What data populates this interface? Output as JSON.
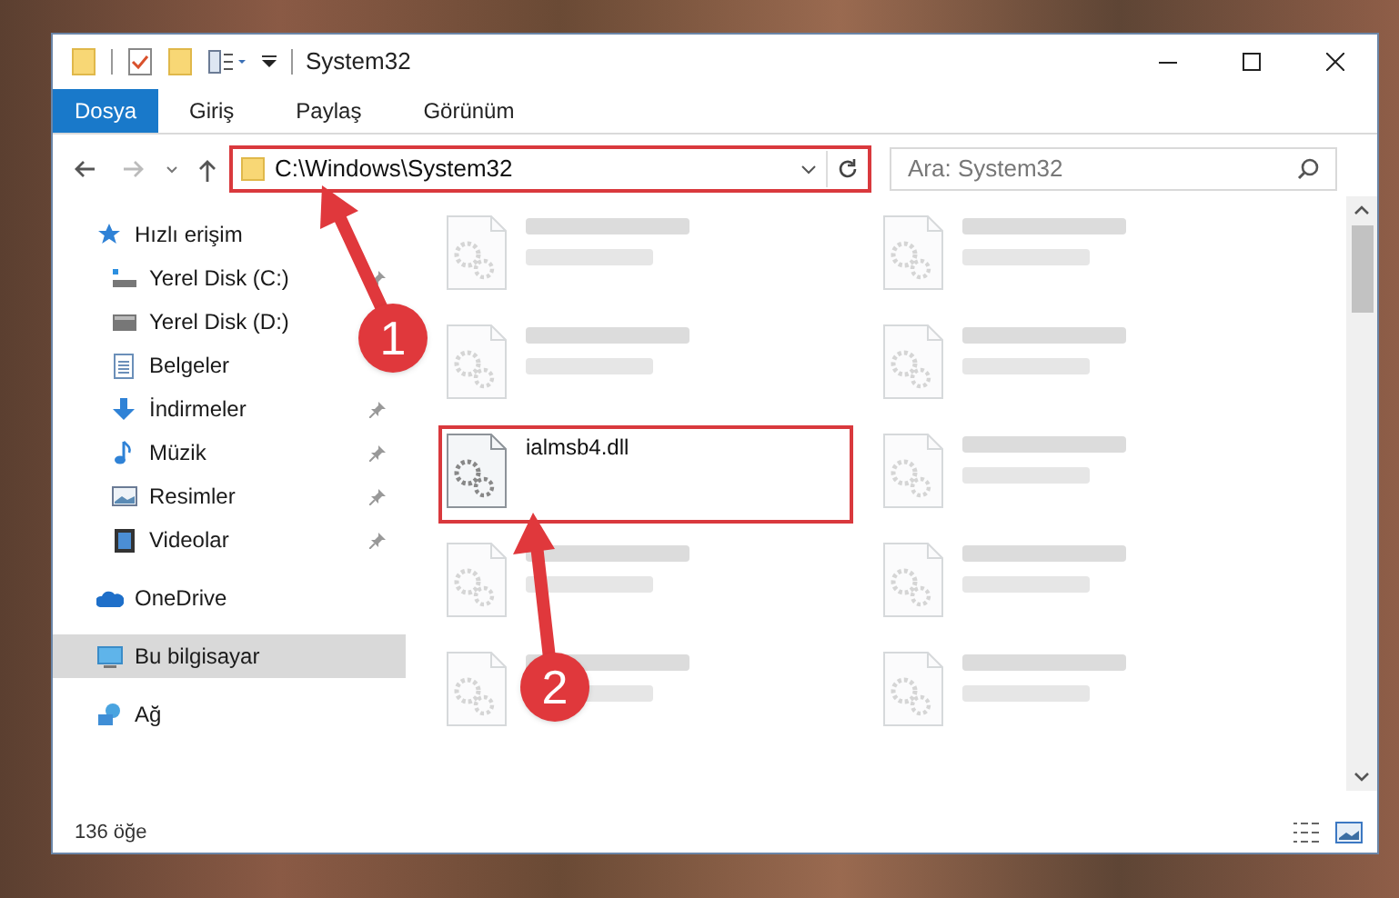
{
  "window": {
    "title": "System32"
  },
  "ribbon_tabs": [
    {
      "label": "Dosya",
      "selected": true
    },
    {
      "label": "Giriş",
      "selected": false
    },
    {
      "label": "Paylaş",
      "selected": false
    },
    {
      "label": "Görünüm",
      "selected": false
    }
  ],
  "address": {
    "path": "C:\\Windows\\System32",
    "highlighted": true
  },
  "search": {
    "placeholder": "Ara: System32"
  },
  "sidebar": [
    {
      "label": "Hızlı erişim",
      "kind": "quick",
      "selected": false,
      "children": [
        {
          "label": "Yerel Disk (C:)",
          "kind": "disk-c",
          "pinned": true,
          "selected": false
        },
        {
          "label": "Yerel Disk (D:)",
          "kind": "disk",
          "pinned": false,
          "selected": false
        },
        {
          "label": "Belgeler",
          "kind": "documents",
          "pinned": false,
          "selected": false
        },
        {
          "label": "İndirmeler",
          "kind": "downloads",
          "pinned": true,
          "selected": false
        },
        {
          "label": "Müzik",
          "kind": "music",
          "pinned": true,
          "selected": false
        },
        {
          "label": "Resimler",
          "kind": "pictures",
          "pinned": true,
          "selected": false
        },
        {
          "label": "Videolar",
          "kind": "videos",
          "pinned": true,
          "selected": false
        }
      ]
    },
    {
      "label": "OneDrive",
      "kind": "cloud",
      "selected": false
    },
    {
      "label": "Bu bilgisayar",
      "kind": "computer",
      "selected": true
    },
    {
      "label": "Ağ",
      "kind": "network",
      "selected": false
    }
  ],
  "files": [
    {
      "blurred": true
    },
    {
      "blurred": true
    },
    {
      "blurred": true
    },
    {
      "blurred": true
    },
    {
      "name": "ialmsb4.dll",
      "blurred": false,
      "highlighted": true
    },
    {
      "blurred": true
    },
    {
      "blurred": true
    },
    {
      "blurred": true
    },
    {
      "blurred": true
    },
    {
      "blurred": true
    }
  ],
  "status_bar": {
    "count": "136 öğe"
  },
  "annotations": [
    {
      "number": "1"
    },
    {
      "number": "2"
    }
  ]
}
